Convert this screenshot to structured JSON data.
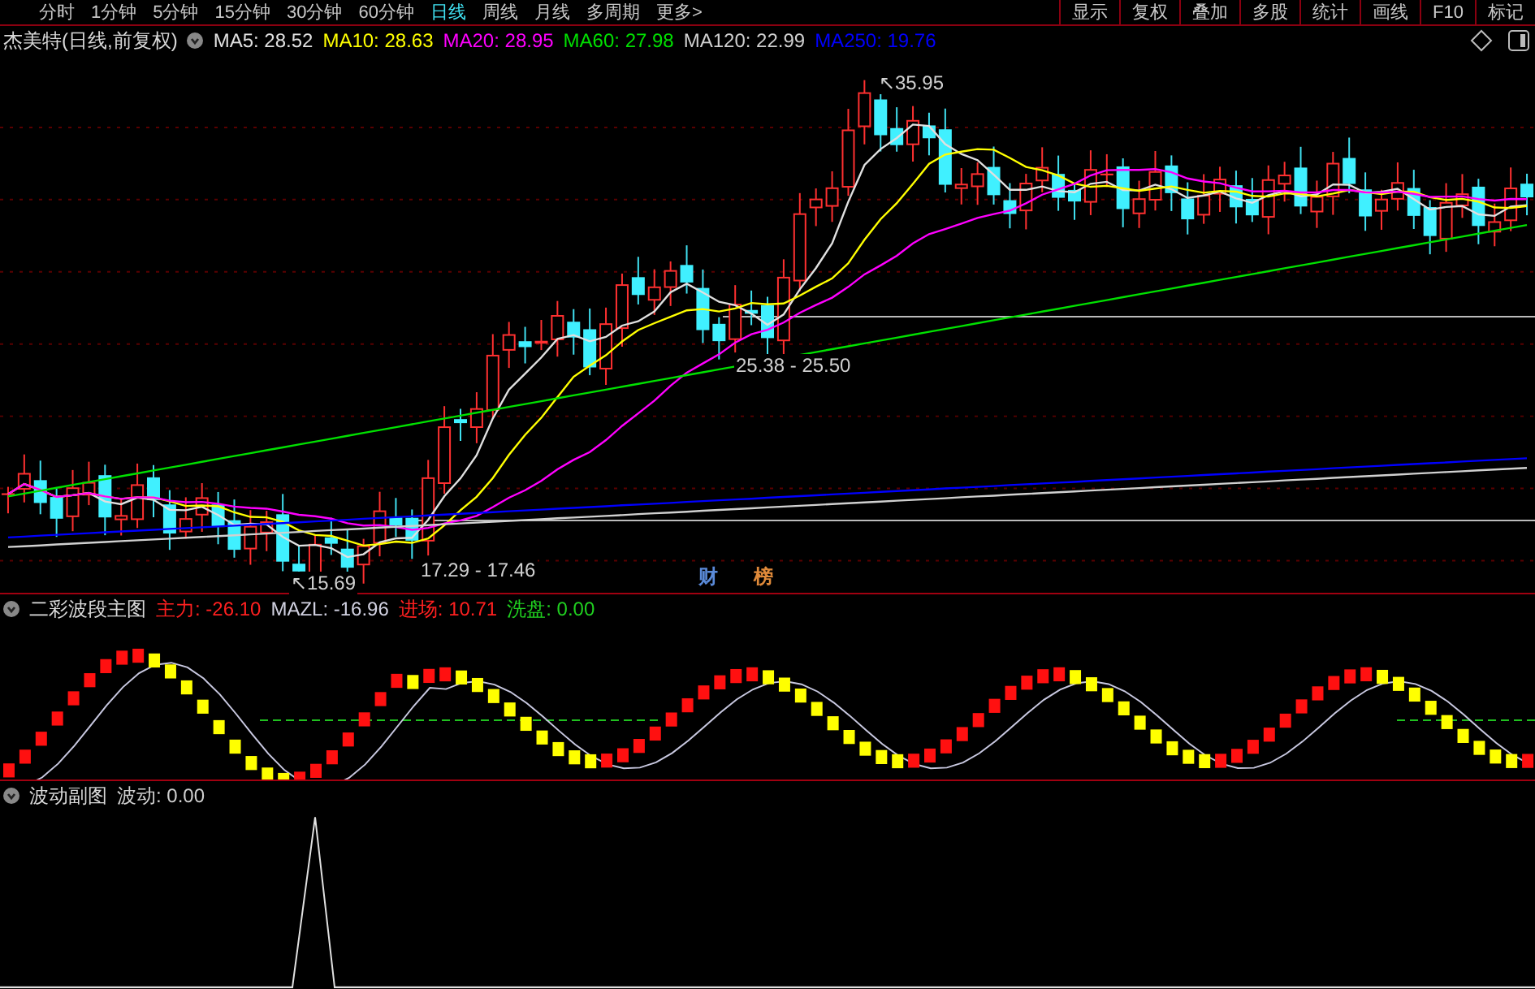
{
  "toolbar": {
    "left": [
      {
        "label": "分时",
        "selected": false
      },
      {
        "label": "1分钟",
        "selected": false
      },
      {
        "label": "5分钟",
        "selected": false
      },
      {
        "label": "15分钟",
        "selected": false
      },
      {
        "label": "30分钟",
        "selected": false
      },
      {
        "label": "60分钟",
        "selected": false
      },
      {
        "label": "日线",
        "selected": true
      },
      {
        "label": "周线",
        "selected": false
      },
      {
        "label": "月线",
        "selected": false
      },
      {
        "label": "多周期",
        "selected": false
      },
      {
        "label": "更多>",
        "selected": false
      }
    ],
    "right": [
      "显示",
      "复权",
      "叠加",
      "多股",
      "统计",
      "画线",
      "F10",
      "标记"
    ]
  },
  "main_chart": {
    "title": "杰美特(日线,前复权)",
    "indicators": [
      {
        "label": "MA5: 28.52",
        "color": "#e0e0e0"
      },
      {
        "label": "MA10: 28.63",
        "color": "#ffff00"
      },
      {
        "label": "MA20: 28.95",
        "color": "#ff00ff"
      },
      {
        "label": "MA60: 27.98",
        "color": "#00e000"
      },
      {
        "label": "MA120: 22.99",
        "color": "#d0d0d0"
      },
      {
        "label": "MA250: 19.76",
        "color": "#0000ff"
      }
    ],
    "annotations": [
      {
        "text": "↖35.95"
      },
      {
        "text": "25.38 - 25.50"
      },
      {
        "text": "17.29 - 17.46"
      },
      {
        "text": "↖15.69"
      }
    ],
    "markers": [
      {
        "text": "财",
        "color": "#5a8ad8"
      },
      {
        "text": "榜",
        "color": "#e08a3a"
      }
    ]
  },
  "wave_panel": {
    "title": "二彩波段主图",
    "indicators": [
      {
        "label": "主力: -26.10",
        "color": "#ff2020"
      },
      {
        "label": "MAZL: -16.96",
        "color": "#d0d0e0"
      },
      {
        "label": "进场: 10.71",
        "color": "#ff2020"
      },
      {
        "label": "洗盘: 0.00",
        "color": "#20d020"
      }
    ]
  },
  "sub_panel": {
    "title": "波动副图",
    "indicators": [
      {
        "label": "波动: 0.00",
        "color": "#d0d0d0"
      }
    ]
  }
}
